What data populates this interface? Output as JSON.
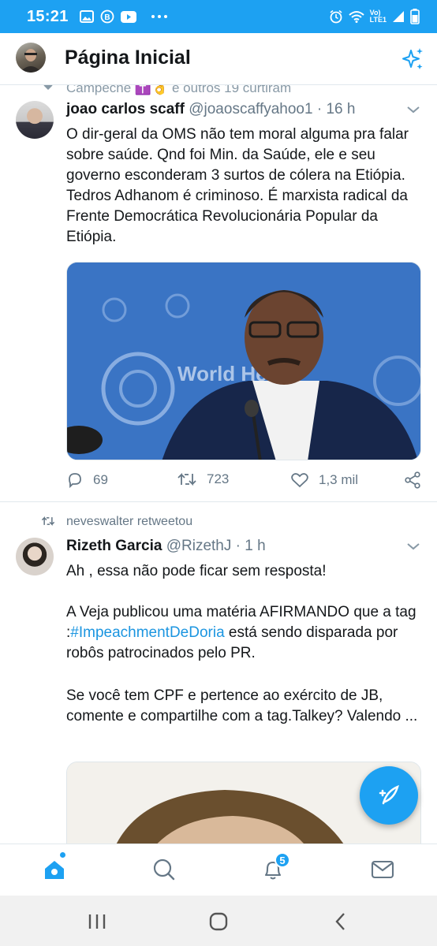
{
  "status_bar": {
    "time": "15:21",
    "network_line1": "Vo)",
    "network_line2": "LTE1"
  },
  "header": {
    "title": "Página Inicial"
  },
  "social_context": {
    "liked_text": "Campeche ✝️👌 e outros 19 curtiram"
  },
  "tweets": [
    {
      "name": "joao carlos scaff",
      "handle": "@joaoscaffyahoo1",
      "separator": "·",
      "time": "16 h",
      "text": "O dir-geral da OMS não tem moral alguma pra falar sobre saúde. Qnd foi Min. da Saúde, ele e seu governo esconderam 3 surtos de cólera na Etiópia. Tedros Adhanom é criminoso. É marxista radical da Frente Democrática Revolucionária Popular da Etiópia.",
      "media_text": "World He Or",
      "replies": "69",
      "retweets": "723",
      "likes": "1,3 mil"
    },
    {
      "retweeted_by": "neveswalter retweetou",
      "name": "Rizeth Garcia",
      "handle": "@RizethJ",
      "separator": "·",
      "time": "1 h",
      "text_p1": "Ah , essa não pode ficar sem resposta!",
      "text_p2a": "A Veja publicou uma matéria AFIRMANDO que a tag :",
      "hashtag": "#ImpeachmentDeDoria",
      "text_p2b": " está sendo disparada por robôs patrocinados pelo PR.",
      "text_p3": "Se você tem CPF e pertence ao exército de JB, comente e compartilhe com a tag.Talkey? Valendo ..."
    }
  ],
  "bottom_nav": {
    "notification_count": "5"
  },
  "colors": {
    "brand": "#1da1f2",
    "text_primary": "#14171a",
    "text_secondary": "#657786",
    "divider": "#e1e8ed"
  },
  "icons": [
    "gallery-icon",
    "b-icon",
    "youtube-icon",
    "more-icon",
    "alarm-icon",
    "wifi-icon",
    "signal-icon",
    "battery-icon",
    "sparkle-icon",
    "chevron-down-icon",
    "reply-icon",
    "retweet-icon",
    "like-icon",
    "share-icon",
    "compose-icon",
    "home-icon",
    "search-icon",
    "notifications-icon",
    "messages-icon"
  ]
}
